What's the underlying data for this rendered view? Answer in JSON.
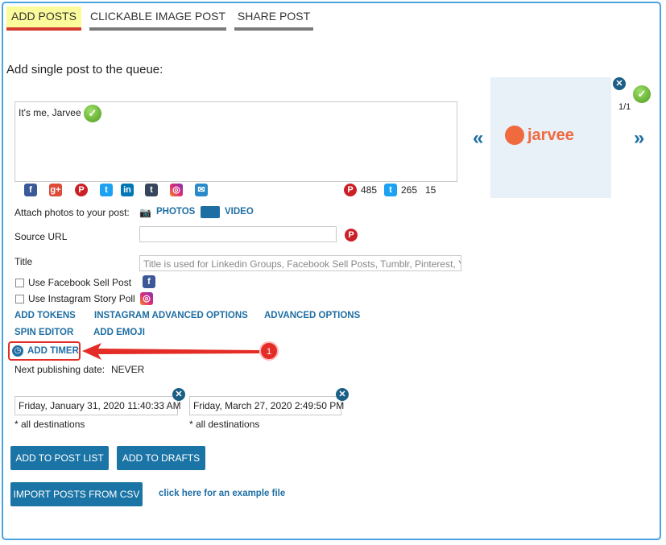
{
  "tabs": [
    {
      "label": "ADD POSTS"
    },
    {
      "label": "CLICKABLE IMAGE POST"
    },
    {
      "label": "SHARE POST"
    }
  ],
  "heading": "Add single post to the queue:",
  "post_text": "It's me, Jarvee",
  "counts": {
    "pinterest": "485",
    "twitter": "265",
    "other": "15"
  },
  "attach": {
    "label": "Attach photos to your post:",
    "photos": "PHOTOS",
    "video": "VIDEO"
  },
  "source_url": {
    "label": "Source URL",
    "value": ""
  },
  "title_field": {
    "label": "Title",
    "placeholder": "Title is used for Linkedin Groups, Facebook Sell Posts, Tumblr, Pinterest, Yo"
  },
  "options": {
    "fb_sell": "Use Facebook Sell Post",
    "ig_poll": "Use Instagram Story Poll"
  },
  "links": {
    "add_tokens": "ADD TOKENS",
    "instagram_advanced": "INSTAGRAM ADVANCED OPTIONS",
    "advanced": "ADVANCED OPTIONS",
    "spin_editor": "SPIN EDITOR",
    "add_emoji": "ADD EMOJI",
    "add_timer": "ADD TIMER"
  },
  "callout_number": "1",
  "next_publishing": {
    "label": "Next publishing date:",
    "value": "NEVER"
  },
  "dates": [
    {
      "value": "Friday, January 31, 2020 11:40:33 AM",
      "note": "* all destinations"
    },
    {
      "value": "Friday, March 27, 2020 2:49:50 PM",
      "note": "* all destinations"
    }
  ],
  "buttons": {
    "add_to_post_list": "ADD TO POST LIST",
    "add_to_drafts": "ADD TO DRAFTS",
    "import_csv": "IMPORT POSTS FROM CSV"
  },
  "example_link": "click here for an example file",
  "preview": {
    "counter": "1/1",
    "logo_text": "jarvee",
    "prev": "«",
    "next": "»"
  },
  "colors": {
    "accent": "#1f6ea3",
    "button": "#1b74a6",
    "active_tab_bg": "#fbfb9c",
    "active_tab_bar": "#d43c2f",
    "callout": "#e52d27"
  }
}
